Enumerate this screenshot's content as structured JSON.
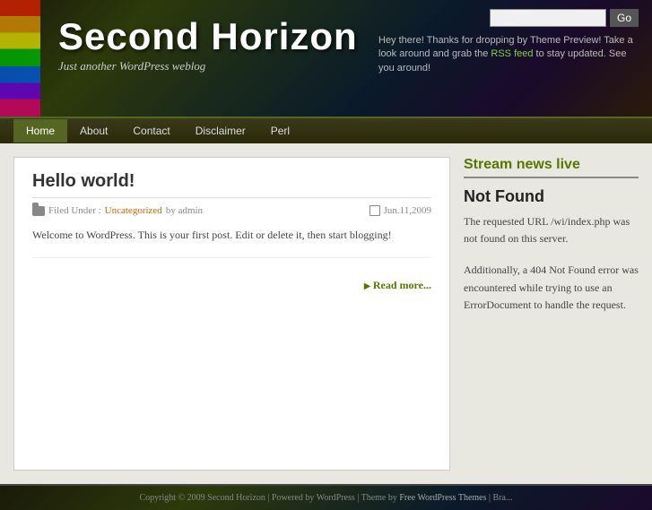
{
  "header": {
    "site_title": "Second Horizon",
    "tagline": "Just another WordPress weblog",
    "search_placeholder": "",
    "search_button_label": "Go",
    "welcome_message": "Hey there! Thanks for dropping by Theme Preview! Take a look around and grab the",
    "rss_link_text": "RSS feed",
    "welcome_message_end": "to stay updated. See you around!"
  },
  "nav": {
    "items": [
      {
        "label": "Home",
        "active": true
      },
      {
        "label": "About",
        "active": false
      },
      {
        "label": "Contact",
        "active": false
      },
      {
        "label": "Disclaimer",
        "active": false
      },
      {
        "label": "Perl",
        "active": false
      }
    ]
  },
  "post": {
    "title": "Hello world!",
    "meta_prefix": "Filed Under :",
    "category": "Uncategorized",
    "meta_by": "by admin",
    "date": "Jun.11,2009",
    "content": "Welcome to WordPress. This is your first post. Edit or delete it, then start blogging!",
    "read_more": "Read more..."
  },
  "sidebar": {
    "widget_title": "Stream news live",
    "not_found_title": "Not Found",
    "not_found_text": "The requested URL /wi/index.php was not found on this server.",
    "not_found_extra": "Additionally, a 404 Not Found error was encountered while trying to use an ErrorDocument to handle the request."
  },
  "footer": {
    "text": "Copyright © 2009 Second Horizon | Powered by WordPress | Theme by",
    "theme_link": "Free WordPress Themes",
    "extra": "| Bra..."
  }
}
